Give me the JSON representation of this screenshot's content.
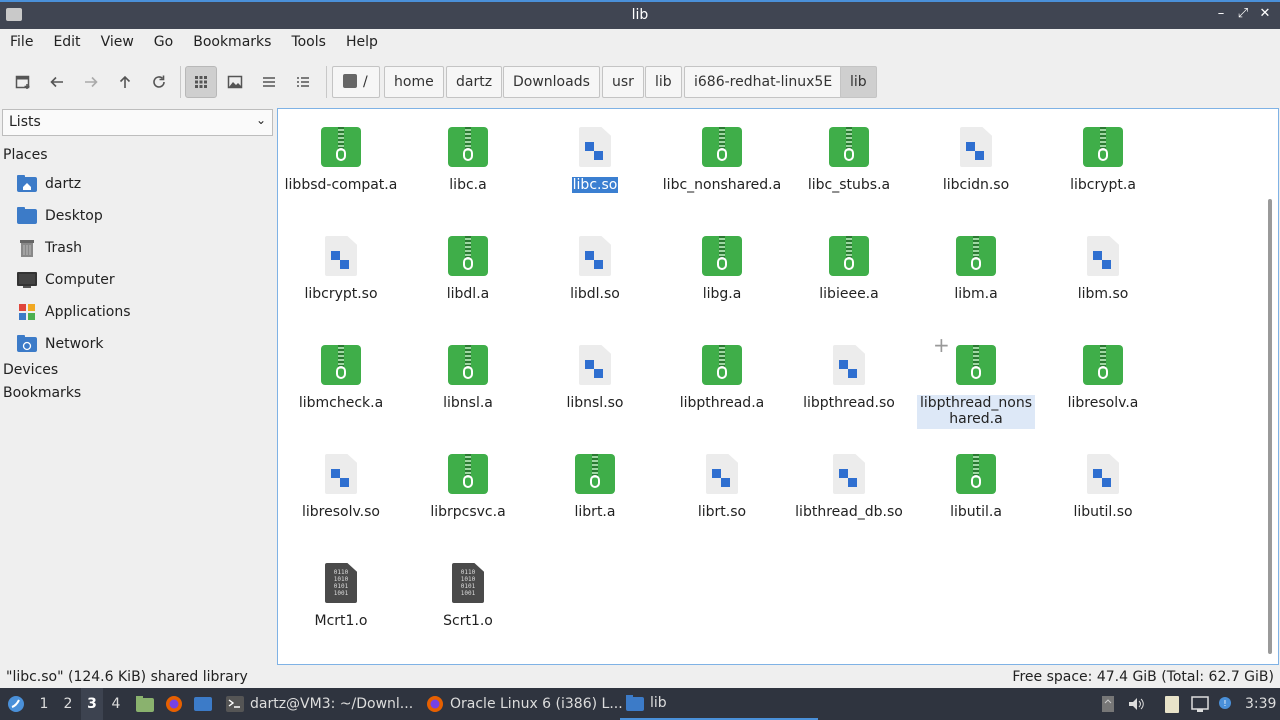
{
  "window": {
    "title": "lib"
  },
  "menu": [
    "File",
    "Edit",
    "View",
    "Go",
    "Bookmarks",
    "Tools",
    "Help"
  ],
  "breadcrumb": [
    "/",
    "home",
    "dartz",
    "Downloads",
    "usr",
    "lib",
    "i686-redhat-linux5E",
    "lib"
  ],
  "sidebar": {
    "selector": "Lists",
    "places_heading": "Places",
    "places": [
      "dartz",
      "Desktop",
      "Trash",
      "Computer",
      "Applications",
      "Network"
    ],
    "devices_heading": "Devices",
    "bookmarks_heading": "Bookmarks"
  },
  "files": [
    {
      "name": "libbsd-compat.a",
      "type": "archive"
    },
    {
      "name": "libc.a",
      "type": "archive"
    },
    {
      "name": "libc.so",
      "type": "shared",
      "selected": true
    },
    {
      "name": "libc_nonshared.a",
      "type": "archive"
    },
    {
      "name": "libc_stubs.a",
      "type": "archive"
    },
    {
      "name": "libcidn.so",
      "type": "shared"
    },
    {
      "name": "libcrypt.a",
      "type": "archive"
    },
    {
      "name": "libcrypt.so",
      "type": "shared"
    },
    {
      "name": "libdl.a",
      "type": "archive"
    },
    {
      "name": "libdl.so",
      "type": "shared"
    },
    {
      "name": "libg.a",
      "type": "archive"
    },
    {
      "name": "libieee.a",
      "type": "archive"
    },
    {
      "name": "libm.a",
      "type": "archive"
    },
    {
      "name": "libm.so",
      "type": "shared"
    },
    {
      "name": "libmcheck.a",
      "type": "archive"
    },
    {
      "name": "libnsl.a",
      "type": "archive"
    },
    {
      "name": "libnsl.so",
      "type": "shared"
    },
    {
      "name": "libpthread.a",
      "type": "archive"
    },
    {
      "name": "libpthread.so",
      "type": "shared"
    },
    {
      "name": "libpthread_nonshared.a",
      "display": "libpthread_nons hared.a",
      "type": "archive",
      "hover": true
    },
    {
      "name": "libresolv.a",
      "type": "archive"
    },
    {
      "name": "libresolv.so",
      "type": "shared"
    },
    {
      "name": "librpcsvc.a",
      "type": "archive"
    },
    {
      "name": "librt.a",
      "type": "archive"
    },
    {
      "name": "librt.so",
      "type": "shared"
    },
    {
      "name": "libthread_db.so",
      "type": "shared"
    },
    {
      "name": "libutil.a",
      "type": "archive"
    },
    {
      "name": "libutil.so",
      "type": "shared"
    },
    {
      "name": "Mcrt1.o",
      "type": "object"
    },
    {
      "name": "Scrt1.o",
      "type": "object"
    }
  ],
  "status": {
    "selection": "\"libc.so\" (124.6 KiB) shared library",
    "free_space": "Free space: 47.4 GiB (Total: 62.7 GiB)"
  },
  "taskbar": {
    "workspaces": [
      "1",
      "2",
      "3",
      "4"
    ],
    "active_workspace": "3",
    "tasks": [
      {
        "label": "dartz@VM3: ~/Downl...",
        "icon": "terminal-icon"
      },
      {
        "label": "Oracle Linux 6 (i386) L...",
        "icon": "firefox-icon"
      },
      {
        "label": "lib",
        "icon": "folder-icon",
        "active": true
      }
    ],
    "clock": "3:39"
  },
  "colors": {
    "accent": "#4a90d9",
    "archive": "#3fae49",
    "selection": "#3b7fd1"
  }
}
